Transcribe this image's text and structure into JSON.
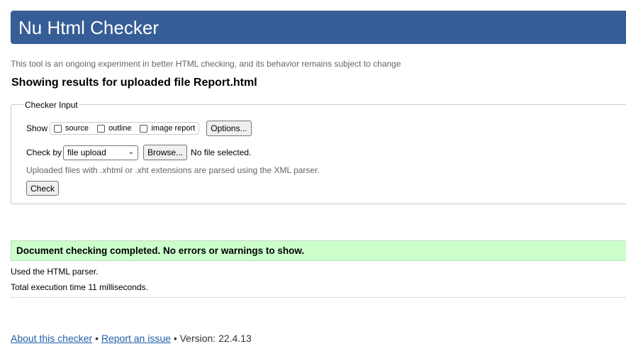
{
  "header": {
    "title": "Nu Html Checker"
  },
  "intro": "This tool is an ongoing experiment in better HTML checking, and its behavior remains subject to change",
  "results_heading": "Showing results for uploaded file Report.html",
  "checker_input": {
    "legend": "Checker Input",
    "show_label": "Show",
    "show_options": [
      {
        "label": "source",
        "checked": false
      },
      {
        "label": "outline",
        "checked": false
      },
      {
        "label": "image report",
        "checked": false
      }
    ],
    "options_button": "Options...",
    "check_by_label": "Check by",
    "check_by_selected": "file upload",
    "browse_button": "Browse...",
    "file_status": "No file selected.",
    "note": "Uploaded files with .xhtml or .xht extensions are parsed using the XML parser.",
    "check_button": "Check"
  },
  "result": {
    "success_message": "Document checking completed. No errors or warnings to show.",
    "parser_note": "Used the HTML parser.",
    "execution_time": "Total execution time 11 milliseconds."
  },
  "footer": {
    "about_link": "About this checker",
    "separator": "•",
    "report_link": "Report an issue",
    "version_text": "Version: 22.4.13"
  },
  "colors": {
    "header_bg": "#365d95",
    "success_bg": "#ccffcc",
    "link": "#1f5fa8"
  }
}
